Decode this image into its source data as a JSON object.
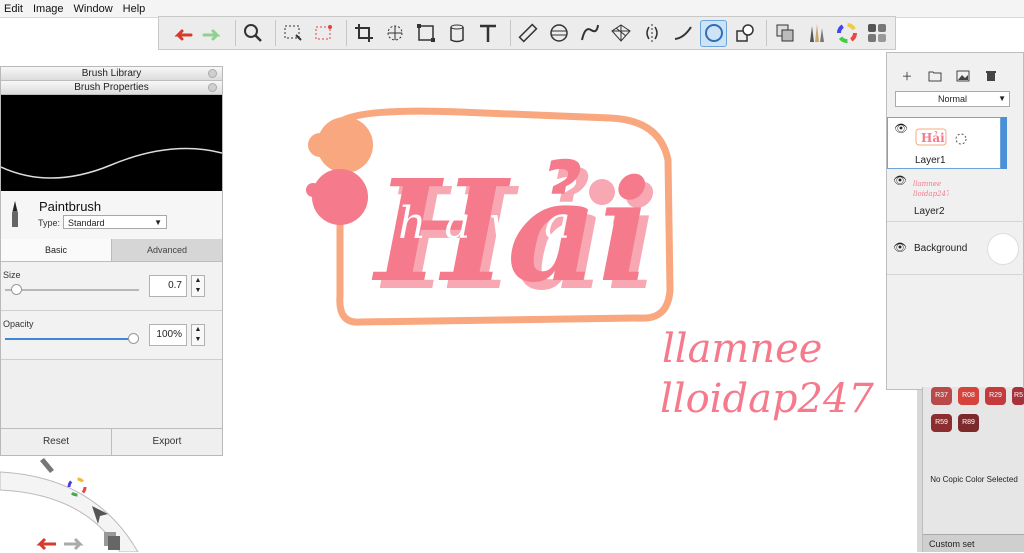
{
  "menu": [
    "Edit",
    "Image",
    "Window",
    "Help"
  ],
  "toolbar": {
    "tools": [
      "undo-icon",
      "redo-icon",
      "magnifier-icon",
      "selection-icon",
      "magic-select-icon",
      "crop-icon",
      "transform-icon",
      "distort-icon",
      "fill-icon",
      "text-icon",
      "ruler-icon",
      "ellipse-guide-icon",
      "french-curve-icon",
      "perspective-icon",
      "symmetry-icon",
      "stroke-icon",
      "predictive-stroke-icon",
      "shapes-icon",
      "layer-copy-icon",
      "brush-set-icon",
      "color-wheel-icon",
      "palettes-icon"
    ],
    "active_tool": "predictive-stroke-icon"
  },
  "brush_library": {
    "title": "Brush Library",
    "properties_title": "Brush Properties",
    "brush_name": "Paintbrush",
    "type_label": "Type:",
    "type_value": "Standard",
    "tab_basic": "Basic",
    "tab_advanced": "Advanced",
    "size_label": "Size",
    "size_value": "0.7",
    "size_level": 0.05,
    "opacity_label": "Opacity",
    "opacity_value": "100%",
    "opacity_level": 1.0,
    "reset_label": "Reset",
    "export_label": "Export"
  },
  "layers": {
    "blend_mode": "Normal",
    "items": [
      {
        "name": "Layer1",
        "selected": true
      },
      {
        "name": "Layer2",
        "selected": false
      },
      {
        "name": "Background",
        "selected": false
      }
    ]
  },
  "copic": {
    "swatches": [
      {
        "code": "R37",
        "color": "#b94a4a"
      },
      {
        "code": "R08",
        "color": "#d5443c"
      },
      {
        "code": "R29",
        "color": "#c63a3e"
      },
      {
        "code": "R5",
        "color": "#a8323a"
      },
      {
        "code": "R59",
        "color": "#8c2e30"
      },
      {
        "code": "R89",
        "color": "#7c2a2c"
      }
    ],
    "no_selection": "No Copic Color Selected",
    "custom_set": "Custom set"
  },
  "artwork": {
    "main_word": "Hải",
    "inner_word": "hawa",
    "signature_line1": "llamnee",
    "signature_line2": "lloidap247"
  },
  "colors": {
    "pink": "#f47a8c",
    "light_pink": "#f8a8b2",
    "peach": "#f8a77f",
    "accent": "#3f86d6"
  }
}
